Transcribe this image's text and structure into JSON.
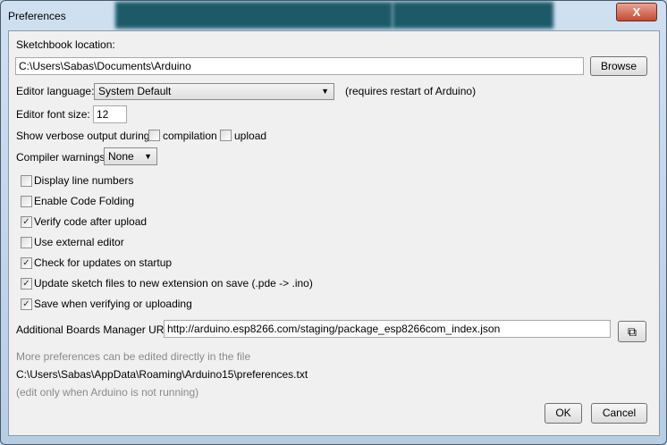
{
  "window": {
    "title": "Preferences",
    "close_label": "X"
  },
  "sketchbook": {
    "label": "Sketchbook location:",
    "value": "C:\\Users\\Sabas\\Documents\\Arduino",
    "browse": "Browse"
  },
  "language": {
    "label": "Editor language:",
    "value": "System Default",
    "note": "(requires restart of Arduino)"
  },
  "font_size": {
    "label": "Editor font size:",
    "value": "12"
  },
  "verbose": {
    "label": "Show verbose output during:",
    "compilation": "compilation",
    "compilation_checked": false,
    "upload": "upload",
    "upload_checked": false
  },
  "warnings": {
    "label": "Compiler warnings:",
    "value": "None"
  },
  "options": [
    {
      "label": "Display line numbers",
      "checked": false
    },
    {
      "label": "Enable Code Folding",
      "checked": false
    },
    {
      "label": "Verify code after upload",
      "checked": true
    },
    {
      "label": "Use external editor",
      "checked": false
    },
    {
      "label": "Check for updates on startup",
      "checked": true
    },
    {
      "label": "Update sketch files to new extension on save (.pde -> .ino)",
      "checked": true
    },
    {
      "label": "Save when verifying or uploading",
      "checked": true
    }
  ],
  "boards": {
    "label": "Additional Boards Manager URLs:",
    "value": "http://arduino.esp8266.com/staging/package_esp8266com_index.json"
  },
  "footer": {
    "more": "More preferences can be edited directly in the file",
    "path": "C:\\Users\\Sabas\\AppData\\Roaming\\Arduino15\\preferences.txt",
    "note": "(edit only when Arduino is not running)",
    "ok": "OK",
    "cancel": "Cancel"
  }
}
